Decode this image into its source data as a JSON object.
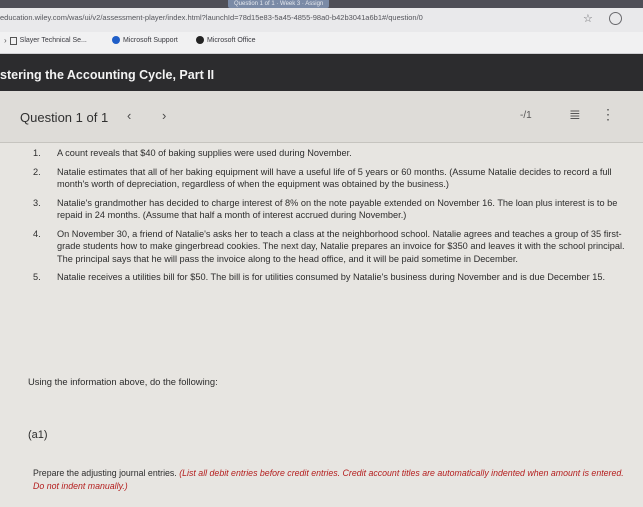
{
  "browser": {
    "tab_title": "Question 1 of 1 · Week 3 · Assign",
    "url": "education.wiley.com/was/ui/v2/assessment-player/index.html?launchId=78d15e83-5a45-4855-98a0-b42b3041a6b1#/question/0",
    "bookmarks": [
      {
        "label": "Slayer Technical Se...",
        "icon": "page-icon"
      },
      {
        "label": "Microsoft Support",
        "icon": "microsoft-icon"
      },
      {
        "label": "Microsoft Office",
        "icon": "office-icon"
      }
    ]
  },
  "course": {
    "title": "stering the Accounting Cycle, Part II"
  },
  "question_bar": {
    "label": "Question 1 of 1",
    "prev": "‹",
    "next": "›",
    "score": "-/1",
    "list_icon": "≣",
    "more_icon": "⋮"
  },
  "items": [
    {
      "num": "1.",
      "text": "A count reveals that $40 of baking supplies were used during November."
    },
    {
      "num": "2.",
      "text": "Natalie estimates that all of her baking equipment will have a useful life of 5 years or 60 months. (Assume Natalie decides to record a full month's worth of depreciation, regardless of when the equipment was obtained by the business.)"
    },
    {
      "num": "3.",
      "text": "Natalie's grandmother has decided to charge interest of 8% on the note payable extended on November 16. The loan plus interest is to be repaid in 24 months. (Assume that half a month of interest accrued during November.)"
    },
    {
      "num": "4.",
      "text": "On November 30, a friend of Natalie's asks her to teach a class at the neighborhood school. Natalie agrees and teaches a group of 35 first-grade students how to make gingerbread cookies. The next day, Natalie prepares an invoice for $350 and leaves it with the school principal. The principal says that he will pass the invoice along to the head office, and it will be paid sometime in December."
    },
    {
      "num": "5.",
      "text": "Natalie receives a utilities bill for $50. The bill is for utilities consumed by Natalie's business during November and is due December 15."
    }
  ],
  "instructions": "Using the information above, do the following:",
  "part_label": "(a1)",
  "prepare": {
    "text": "Prepare the adjusting journal entries.",
    "note": "(List all debit entries before credit entries. Credit account titles are automatically indented when amount is entered. Do not indent manually.)"
  }
}
